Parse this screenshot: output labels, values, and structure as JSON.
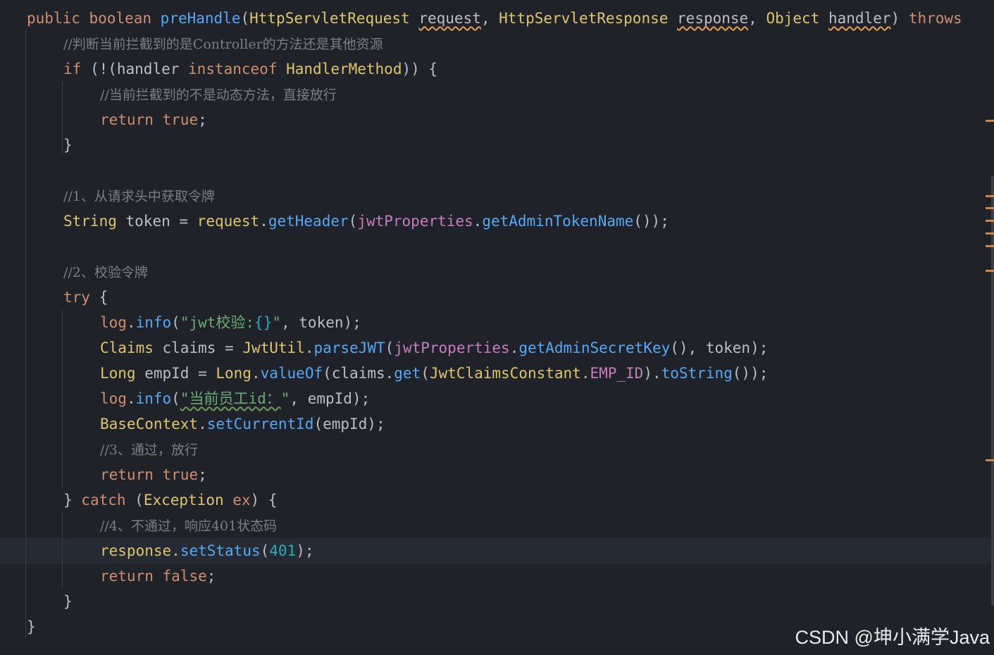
{
  "editor": {
    "lines": [
      [
        [
          "t-kw",
          "public "
        ],
        [
          "t-kw",
          "boolean "
        ],
        [
          "t-fn",
          "preHandle"
        ],
        [
          "t-punc",
          "("
        ],
        [
          "t-cls",
          "HttpServletRequest "
        ],
        [
          "t-par",
          "request"
        ],
        [
          "t-punc",
          ", "
        ],
        [
          "t-cls",
          "HttpServletResponse "
        ],
        [
          "t-par",
          "response"
        ],
        [
          "t-punc",
          ", "
        ],
        [
          "t-cls",
          "Object "
        ],
        [
          "t-par",
          "handler"
        ],
        [
          "t-punc",
          ") "
        ],
        [
          "t-kw",
          "throws"
        ]
      ],
      [
        [
          "t-cmt",
          "//判断当前拦截到的是Controller的方法还是其他资源"
        ]
      ],
      [
        [
          "t-kw",
          "if "
        ],
        [
          "t-punc",
          "(!("
        ],
        [
          "t-type",
          "handler "
        ],
        [
          "t-kw",
          "instanceof "
        ],
        [
          "t-cls",
          "HandlerMethod"
        ],
        [
          "t-punc",
          ")) {"
        ]
      ],
      [
        [
          "t-cmt",
          "//当前拦截到的不是动态方法，直接放行"
        ]
      ],
      [
        [
          "t-kw",
          "return "
        ],
        [
          "t-kw",
          "true"
        ],
        [
          "t-punc",
          ";"
        ]
      ],
      [
        [
          "t-punc",
          "}"
        ]
      ],
      [],
      [
        [
          "t-cmt",
          "//1、从请求头中获取令牌"
        ]
      ],
      [
        [
          "t-cls",
          "String "
        ],
        [
          "t-type",
          "token "
        ],
        [
          "t-punc",
          "= "
        ],
        [
          "t-cls",
          "request"
        ],
        [
          "t-punc",
          "."
        ],
        [
          "t-fn",
          "getHeader"
        ],
        [
          "t-punc",
          "("
        ],
        [
          "t-fld",
          "jwtProperties"
        ],
        [
          "t-punc",
          "."
        ],
        [
          "t-fn",
          "getAdminTokenName"
        ],
        [
          "t-punc",
          "());"
        ]
      ],
      [],
      [
        [
          "t-cmt",
          "//2、校验令牌"
        ]
      ],
      [
        [
          "t-kw",
          "try "
        ],
        [
          "t-punc",
          "{"
        ]
      ],
      [
        [
          "t-log",
          "log"
        ],
        [
          "t-punc",
          "."
        ],
        [
          "t-fn",
          "info"
        ],
        [
          "t-punc",
          "("
        ],
        [
          "t-str",
          "\"jwt校验:"
        ],
        [
          "t-num",
          "{}"
        ],
        [
          "t-str",
          "\""
        ],
        [
          "t-punc",
          ", token);"
        ]
      ],
      [
        [
          "t-cls",
          "Claims "
        ],
        [
          "t-type",
          "claims "
        ],
        [
          "t-punc",
          "= "
        ],
        [
          "t-cls",
          "JwtUtil"
        ],
        [
          "t-punc",
          "."
        ],
        [
          "t-fn",
          "parseJWT"
        ],
        [
          "t-punc",
          "("
        ],
        [
          "t-fld",
          "jwtProperties"
        ],
        [
          "t-punc",
          "."
        ],
        [
          "t-fn",
          "getAdminSecretKey"
        ],
        [
          "t-punc",
          "(), token);"
        ]
      ],
      [
        [
          "t-cls",
          "Long "
        ],
        [
          "t-type",
          "empId "
        ],
        [
          "t-punc",
          "= "
        ],
        [
          "t-cls",
          "Long"
        ],
        [
          "t-punc",
          "."
        ],
        [
          "t-fn",
          "valueOf"
        ],
        [
          "t-punc",
          "(claims."
        ],
        [
          "t-fn",
          "get"
        ],
        [
          "t-punc",
          "("
        ],
        [
          "t-cls",
          "JwtClaimsConstant"
        ],
        [
          "t-punc",
          "."
        ],
        [
          "t-const",
          "EMP_ID"
        ],
        [
          "t-punc",
          ")."
        ],
        [
          "t-fn",
          "toString"
        ],
        [
          "t-punc",
          "());"
        ]
      ],
      [
        [
          "t-log",
          "log"
        ],
        [
          "t-punc",
          "."
        ],
        [
          "t-fn",
          "info"
        ],
        [
          "t-punc",
          "("
        ],
        [
          "t-str t-warn",
          "\"当前员工id："
        ],
        [
          "t-str",
          "\""
        ],
        [
          "t-punc",
          ", empId);"
        ]
      ],
      [
        [
          "t-cls",
          "BaseContext"
        ],
        [
          "t-punc",
          "."
        ],
        [
          "t-fn",
          "setCurrentId"
        ],
        [
          "t-punc",
          "(empId);"
        ]
      ],
      [
        [
          "t-cmt",
          "//3、通过，放行"
        ]
      ],
      [
        [
          "t-kw",
          "return "
        ],
        [
          "t-kw",
          "true"
        ],
        [
          "t-punc",
          ";"
        ]
      ],
      [
        [
          "t-punc",
          "} "
        ],
        [
          "t-kw",
          "catch "
        ],
        [
          "t-punc",
          "("
        ],
        [
          "t-cls",
          "Exception "
        ],
        [
          "t-kw",
          "ex"
        ],
        [
          "t-punc",
          ") {"
        ]
      ],
      [
        [
          "t-cmt",
          "//4、不通过，响应401状态码"
        ]
      ],
      [
        [
          "t-cls",
          "response"
        ],
        [
          "t-punc",
          "."
        ],
        [
          "t-fn",
          "setStatus"
        ],
        [
          "t-punc",
          "("
        ],
        [
          "t-num",
          "401"
        ],
        [
          "t-punc",
          ");"
        ]
      ],
      [
        [
          "t-kw",
          "return "
        ],
        [
          "t-kw",
          "false"
        ],
        [
          "t-punc",
          ";"
        ]
      ],
      [
        [
          "t-punc",
          "}"
        ]
      ],
      [
        [
          "t-punc",
          "}"
        ]
      ]
    ]
  },
  "watermark": "CSDN @坤小满学Java",
  "colors": {
    "background": "#1f2329",
    "keyword": "#cf8e6d",
    "function": "#56a8f5",
    "field": "#c77dbb",
    "string": "#6aab73",
    "number": "#2aacb8",
    "comment": "#7a7e85",
    "marker": "#d9843b"
  }
}
